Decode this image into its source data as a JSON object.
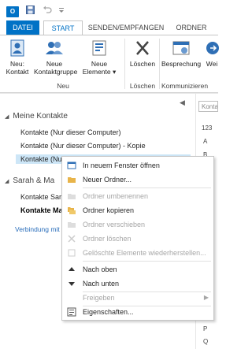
{
  "quick_access": {
    "app": "O",
    "icons": [
      "save-icon",
      "undo-icon",
      "customize-icon"
    ]
  },
  "tabs": [
    "DATEI",
    "START",
    "SENDEN/EMPFANGEN",
    "ORDNER"
  ],
  "ribbon": {
    "buttons": [
      {
        "label1": "Neu:",
        "label2": "Kontakt",
        "icon": "new-contact-icon"
      },
      {
        "label1": "Neue",
        "label2": "Kontaktgruppe",
        "icon": "contact-group-icon"
      },
      {
        "label1": "Neue",
        "label2": "Elemente ▾",
        "icon": "new-items-icon"
      },
      {
        "label1": "Löschen",
        "label2": "",
        "icon": "delete-icon"
      },
      {
        "label1": "Besprechung",
        "label2": "",
        "icon": "meeting-icon"
      },
      {
        "label1": "Wei",
        "label2": "",
        "icon": "forward-icon"
      }
    ],
    "groups": [
      "Neu",
      "Löschen",
      "Kommunizieren"
    ]
  },
  "collapse_label": "◀",
  "sidebar": {
    "section1": "Meine Kontakte",
    "folders1": [
      "Kontakte (Nur dieser Computer)",
      "Kontakte (Nur dieser Computer) - Kopie",
      "Kontakte (Nur dieser Computer) - Kopie (2)"
    ],
    "section2": "Sarah & Ma",
    "folders2": [
      "Kontakte Sara",
      "Kontakte Ma"
    ],
    "link": "Verbindung mit"
  },
  "search_placeholder": "Konta",
  "alphabet": [
    "123",
    "A",
    "B",
    "O",
    "P",
    "Q"
  ],
  "context_menu": [
    {
      "label": "In neuem Fenster öffnen",
      "icon": "open-window-icon",
      "disabled": false
    },
    {
      "label": "Neuer Ordner...",
      "icon": "new-folder-icon",
      "disabled": false
    },
    {
      "label": "Ordner umbenennen",
      "icon": "rename-folder-icon",
      "disabled": true
    },
    {
      "label": "Ordner kopieren",
      "icon": "copy-folder-icon",
      "disabled": false
    },
    {
      "label": "Ordner verschieben",
      "icon": "move-folder-icon",
      "disabled": true
    },
    {
      "label": "Ordner löschen",
      "icon": "delete-folder-icon",
      "disabled": true
    },
    {
      "label": "Gelöschte Elemente wiederherstellen...",
      "icon": "restore-icon",
      "disabled": true
    },
    {
      "label": "Nach oben",
      "icon": "move-up-icon",
      "disabled": false
    },
    {
      "label": "Nach unten",
      "icon": "move-down-icon",
      "disabled": false
    },
    {
      "label": "Freigeben",
      "icon": "share-icon",
      "disabled": true
    },
    {
      "label": "Eigenschaften...",
      "icon": "properties-icon",
      "disabled": false
    }
  ]
}
